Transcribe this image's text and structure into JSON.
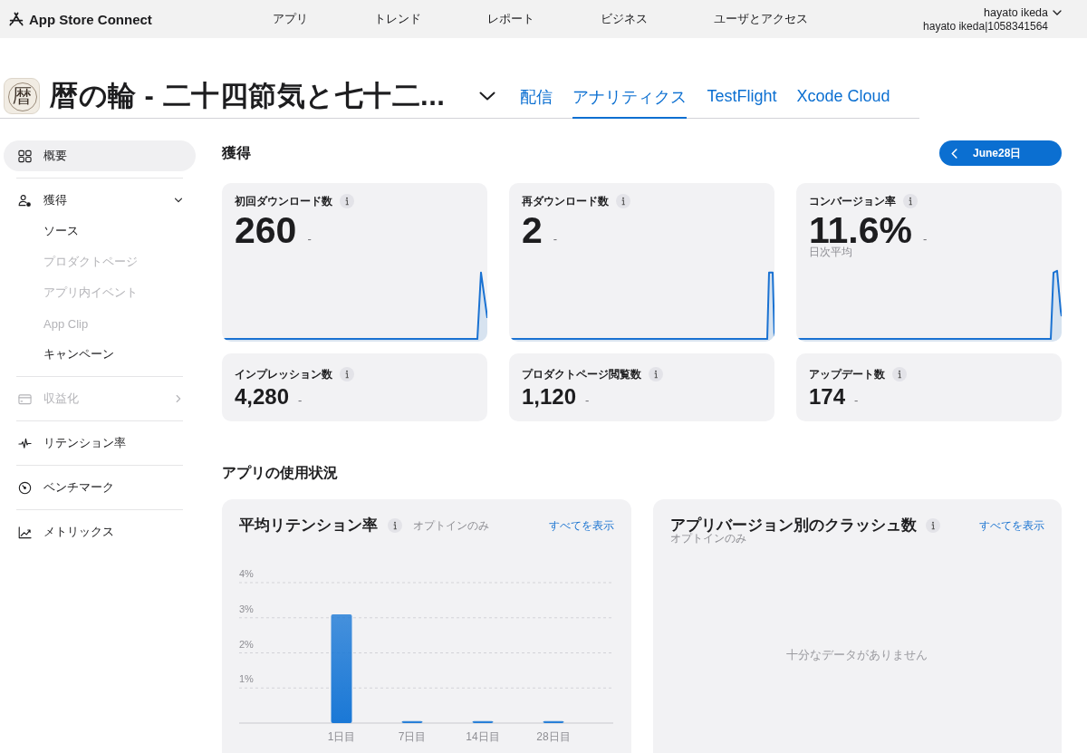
{
  "top_bar": {
    "logo": "App Store Connect",
    "nav": [
      {
        "label": "アプリ"
      },
      {
        "label": "トレンド"
      },
      {
        "label": "レポート"
      },
      {
        "label": "ビジネス"
      },
      {
        "label": "ユーザとアクセス"
      }
    ],
    "user": {
      "name": "hayato ikeda",
      "account": "hayato ikeda|1058341564"
    }
  },
  "app_header": {
    "icon_glyph": "暦",
    "title": "暦の輪 - 二十四節気と七十二...",
    "tabs": [
      {
        "label": "配信",
        "selected": false
      },
      {
        "label": "アナリティクス",
        "selected": true
      },
      {
        "label": "TestFlight",
        "selected": false
      },
      {
        "label": "Xcode Cloud",
        "selected": false
      }
    ]
  },
  "sidebar": {
    "items": [
      {
        "kind": "link",
        "label": "概要",
        "selected": true,
        "disabled": false
      },
      {
        "kind": "group",
        "label": "獲得",
        "selected": false,
        "disabled": false,
        "expanded": true,
        "children": [
          {
            "label": "ソース",
            "selected": false,
            "disabled": false
          },
          {
            "label": "プロダクトページ",
            "selected": false,
            "disabled": true
          },
          {
            "label": "アプリ内イベント",
            "selected": false,
            "disabled": true
          },
          {
            "label": "App Clip",
            "selected": false,
            "disabled": true
          },
          {
            "label": "キャンペーン",
            "selected": false,
            "disabled": false
          }
        ]
      },
      {
        "kind": "group",
        "label": "収益化",
        "selected": false,
        "disabled": true,
        "expanded": false
      },
      {
        "kind": "link",
        "label": "リテンション率",
        "selected": false,
        "disabled": false
      },
      {
        "kind": "link",
        "label": "ベンチマーク",
        "selected": false,
        "disabled": false
      },
      {
        "kind": "link",
        "label": "メトリックス",
        "selected": false,
        "disabled": false
      }
    ]
  },
  "acquisition": {
    "title": "獲得",
    "date_button": "June28日",
    "metrics": [
      {
        "kind": "trend",
        "label": "初回ダウンロード数",
        "value": "260",
        "delta": "-"
      },
      {
        "kind": "trend",
        "label": "再ダウンロード数",
        "value": "2",
        "delta": "-"
      },
      {
        "kind": "trend",
        "label": "コンバージョン率",
        "value": "11.6%",
        "delta": "-",
        "note": "日次平均"
      },
      {
        "kind": "compact",
        "label": "インプレッション数",
        "value": "4,280",
        "delta": "-"
      },
      {
        "kind": "compact",
        "label": "プロダクトページ閲覧数",
        "value": "1,120",
        "delta": "-"
      },
      {
        "kind": "compact",
        "label": "アップデート数",
        "value": "174",
        "delta": "-"
      }
    ]
  },
  "usage": {
    "title": "アプリの使用状況",
    "panels": [
      {
        "kind": "chart",
        "title": "平均リテンション率",
        "note": "オプトインのみ",
        "link": "すべてを表示",
        "chart_data": {
          "type": "bar",
          "categories": [
            "1日目",
            "7日目",
            "14日目",
            "28日目"
          ],
          "values": [
            3.1,
            0.06,
            0.06,
            0.06
          ],
          "color": "#1a78d6",
          "ylim": [
            0,
            4
          ],
          "yticks": [
            {
              "value": 1,
              "label": "1%"
            },
            {
              "value": 2,
              "label": "2%"
            },
            {
              "value": 3,
              "label": "3%"
            },
            {
              "value": 4,
              "label": "4%"
            }
          ],
          "grid": true
        }
      },
      {
        "kind": "empty",
        "title": "アプリバージョン別のクラッシュ数",
        "note": "オプトインのみ",
        "link": "すべてを表示",
        "empty_message": "十分なデータがありません"
      }
    ]
  }
}
